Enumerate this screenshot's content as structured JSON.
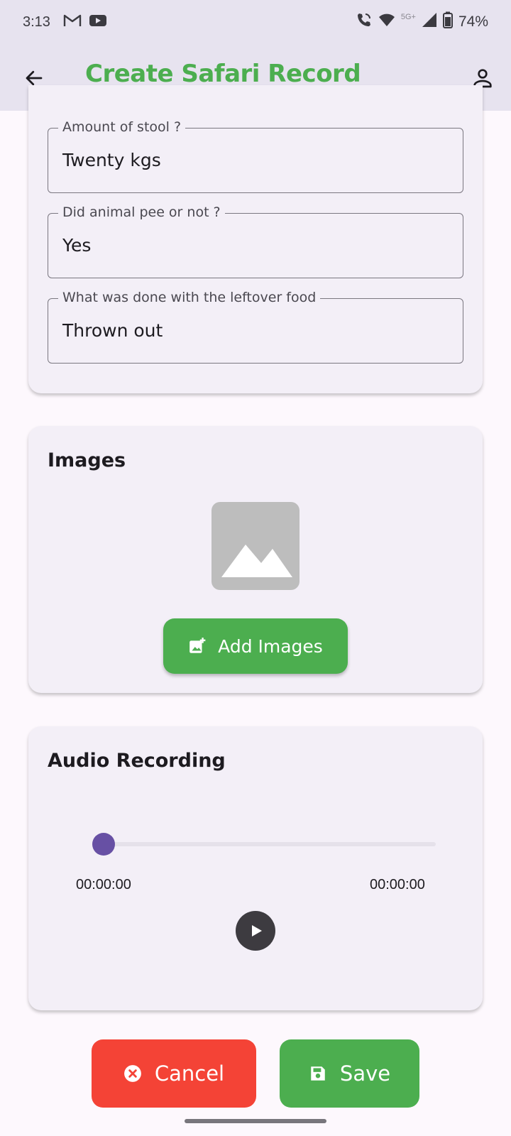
{
  "status_bar": {
    "time": "3:13",
    "network": "5G+",
    "battery": "74%",
    "icons": [
      "gmail-icon",
      "youtube-icon",
      "wifi-calling-icon",
      "wifi-icon",
      "signal-icon",
      "battery-icon"
    ]
  },
  "app_bar": {
    "title": "Create Safari Record",
    "back_icon": "arrow-back-icon",
    "profile_icon": "person-outline-icon"
  },
  "form_fields": [
    {
      "label": "Amount of stool ?",
      "value": "Twenty kgs"
    },
    {
      "label": "Did animal pee or not ?",
      "value": "Yes"
    },
    {
      "label": "What was done with the leftover food",
      "value": "Thrown out"
    }
  ],
  "images_section": {
    "title": "Images",
    "placeholder_icon": "image-placeholder-icon",
    "add_button_label": "Add Images",
    "add_button_icon": "add-photo-icon"
  },
  "audio_section": {
    "title": "Audio Recording",
    "current_time": "00:00:00",
    "total_time": "00:00:00",
    "progress": 0,
    "play_icon": "play-icon"
  },
  "actions": {
    "cancel_label": "Cancel",
    "save_label": "Save"
  },
  "colors": {
    "accent_green": "#4cae4f",
    "cancel_red": "#f44336",
    "slider_purple": "#6750a4",
    "app_bar_bg": "#e7e3ef"
  }
}
